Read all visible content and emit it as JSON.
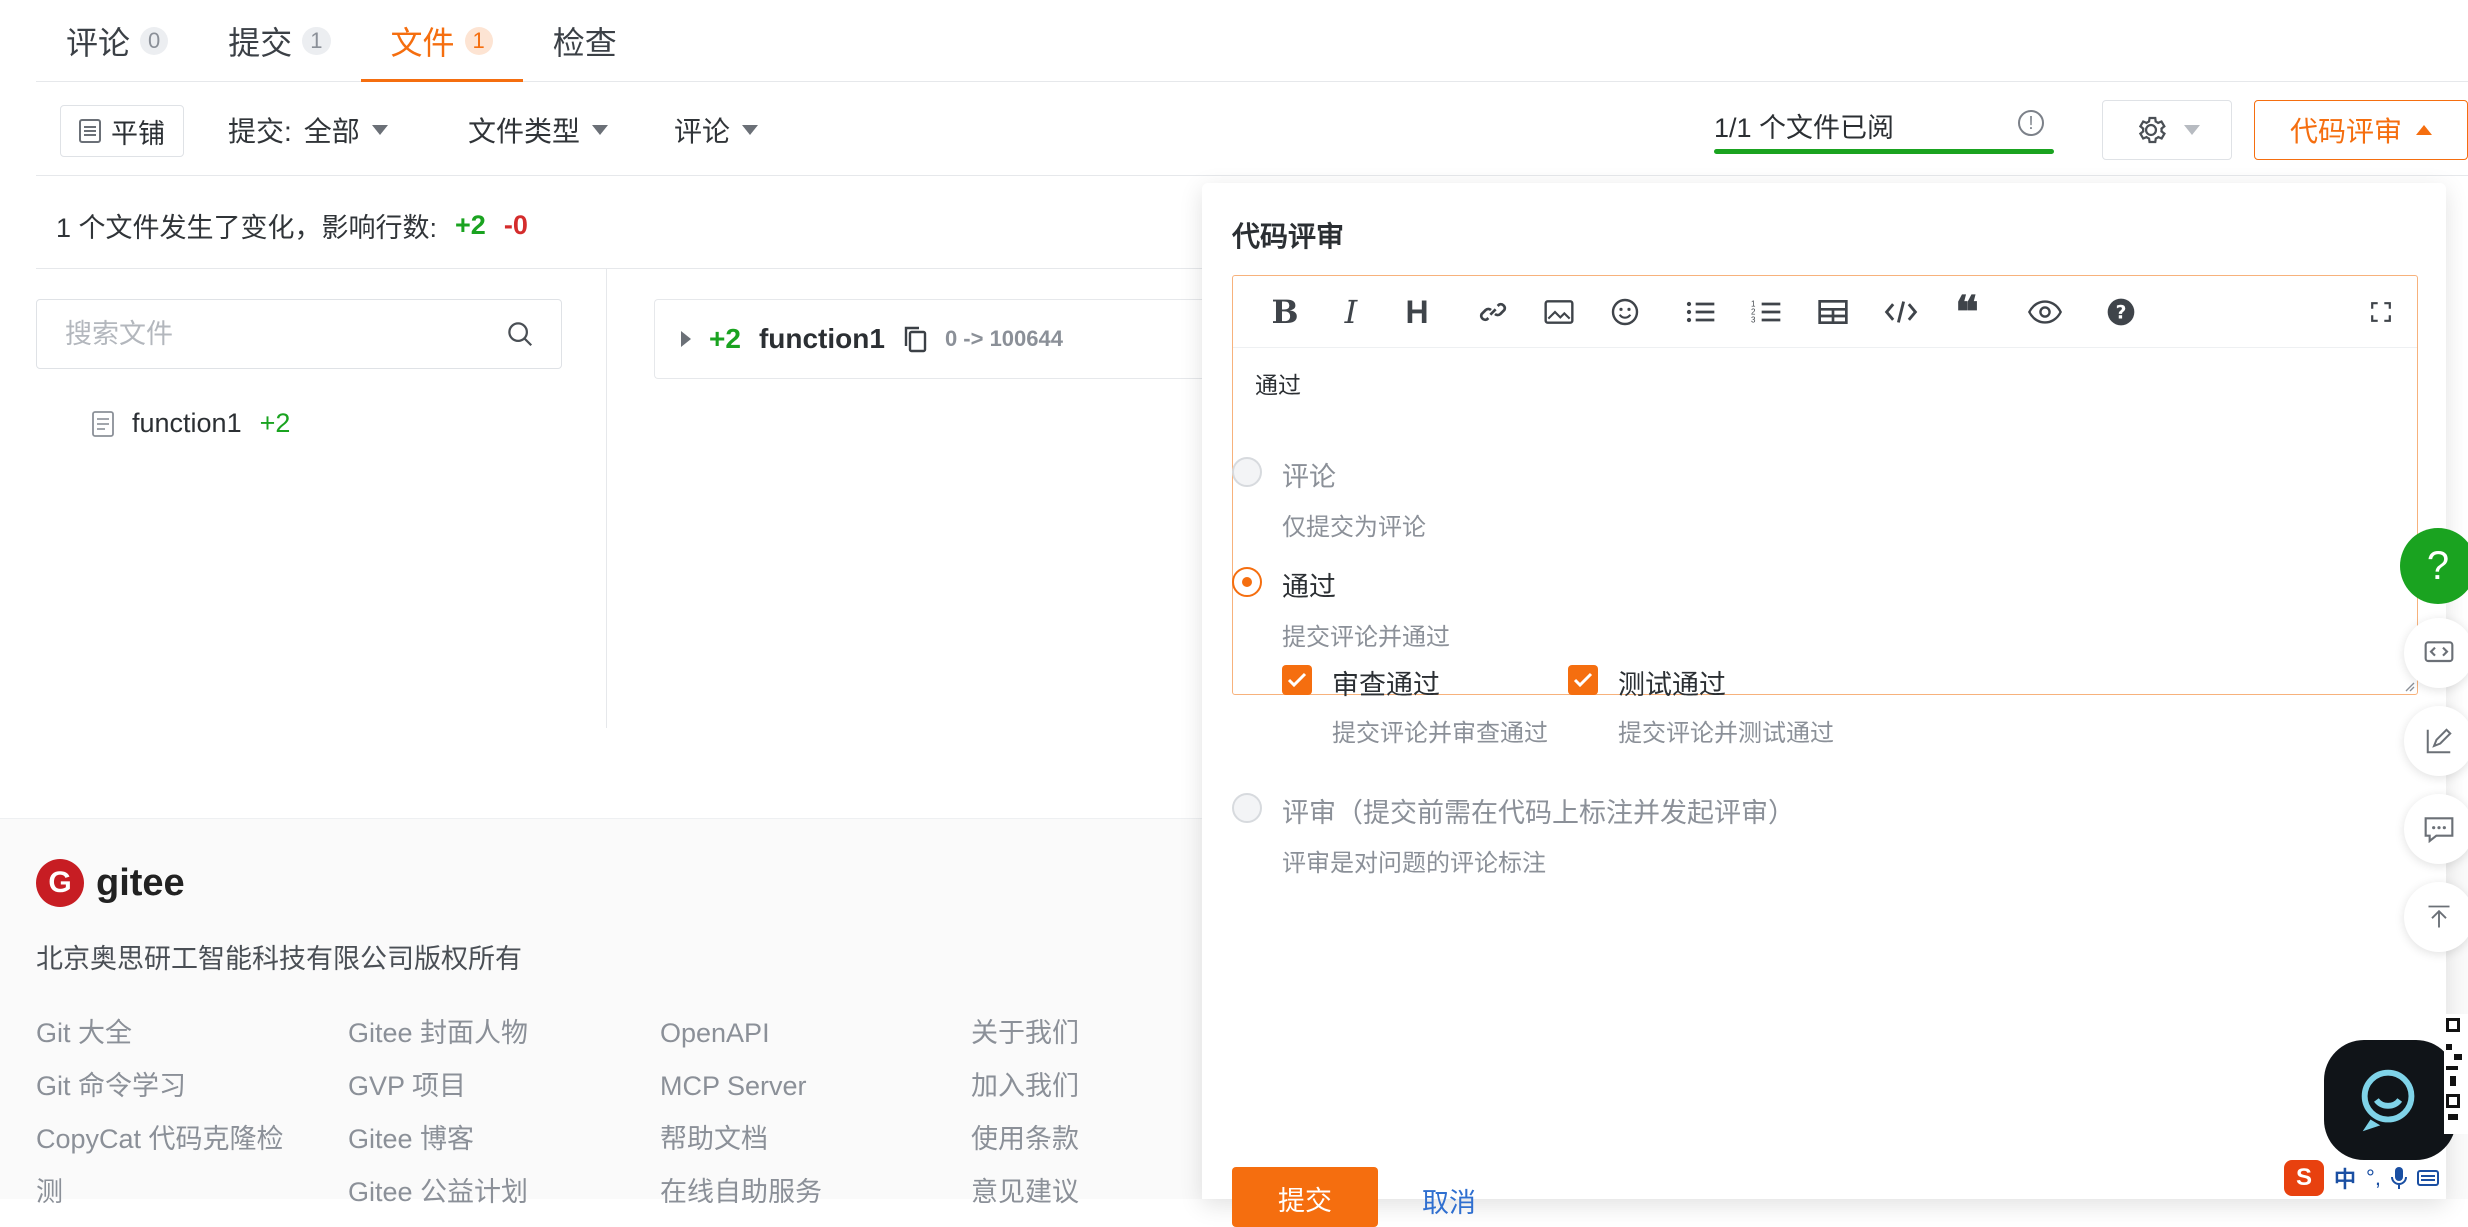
{
  "tabs": [
    {
      "label": "评论",
      "count": "0"
    },
    {
      "label": "提交",
      "count": "1"
    },
    {
      "label": "文件",
      "count": "1",
      "active": true
    },
    {
      "label": "检查"
    }
  ],
  "toolbar": {
    "tile_label": "平铺",
    "filter_commit_label": "提交:",
    "filter_commit_value": "全部",
    "filter_filetype": "文件类型",
    "filter_comment": "评论",
    "viewed_text": "1/1 个文件已阅",
    "review_button": "代码评审"
  },
  "summary": {
    "text": "1 个文件发生了变化，影响行数:",
    "added": "+2",
    "removed": "-0"
  },
  "file_search": {
    "placeholder": "搜索文件"
  },
  "file_list": [
    {
      "name": "function1",
      "added": "+2"
    }
  ],
  "file_header": {
    "added": "+2",
    "name": "function1",
    "mode": "0 -> 100644"
  },
  "footer": {
    "brand": "gitee",
    "copyright": "北京奥思研工智能科技有限公司版权所有",
    "columns": [
      [
        "Git 大全",
        "Git 命令学习",
        "CopyCat 代码克隆检",
        "测"
      ],
      [
        "Gitee 封面人物",
        "GVP 项目",
        "Gitee 博客",
        "Gitee 公益计划"
      ],
      [
        "OpenAPI",
        "MCP Server",
        "帮助文档",
        "在线自助服务"
      ],
      [
        "关于我们",
        "加入我们",
        "使用条款",
        "意见建议"
      ]
    ]
  },
  "review_panel": {
    "title": "代码评审",
    "editor_text": "通过",
    "options": [
      {
        "label": "评论",
        "desc": "仅提交为评论",
        "selected": false
      },
      {
        "label": "通过",
        "desc": "提交评论并通过",
        "selected": true
      },
      {
        "label": "评审（提交前需在代码上标注并发起评审）",
        "desc": "评审是对问题的评论标注",
        "selected": false
      }
    ],
    "checks": [
      {
        "label": "审查通过",
        "desc": "提交评论并审查通过",
        "checked": true
      },
      {
        "label": "测试通过",
        "desc": "提交评论并测试通过",
        "checked": true
      }
    ],
    "submit_label": "提交",
    "cancel_label": "取消"
  },
  "floating": {
    "help_symbol": "?"
  },
  "ime": {
    "lang": "中"
  },
  "colors": {
    "accent": "#f56e0f",
    "green": "#1aa320",
    "red": "#d42c2c",
    "brand": "#c71d23"
  }
}
